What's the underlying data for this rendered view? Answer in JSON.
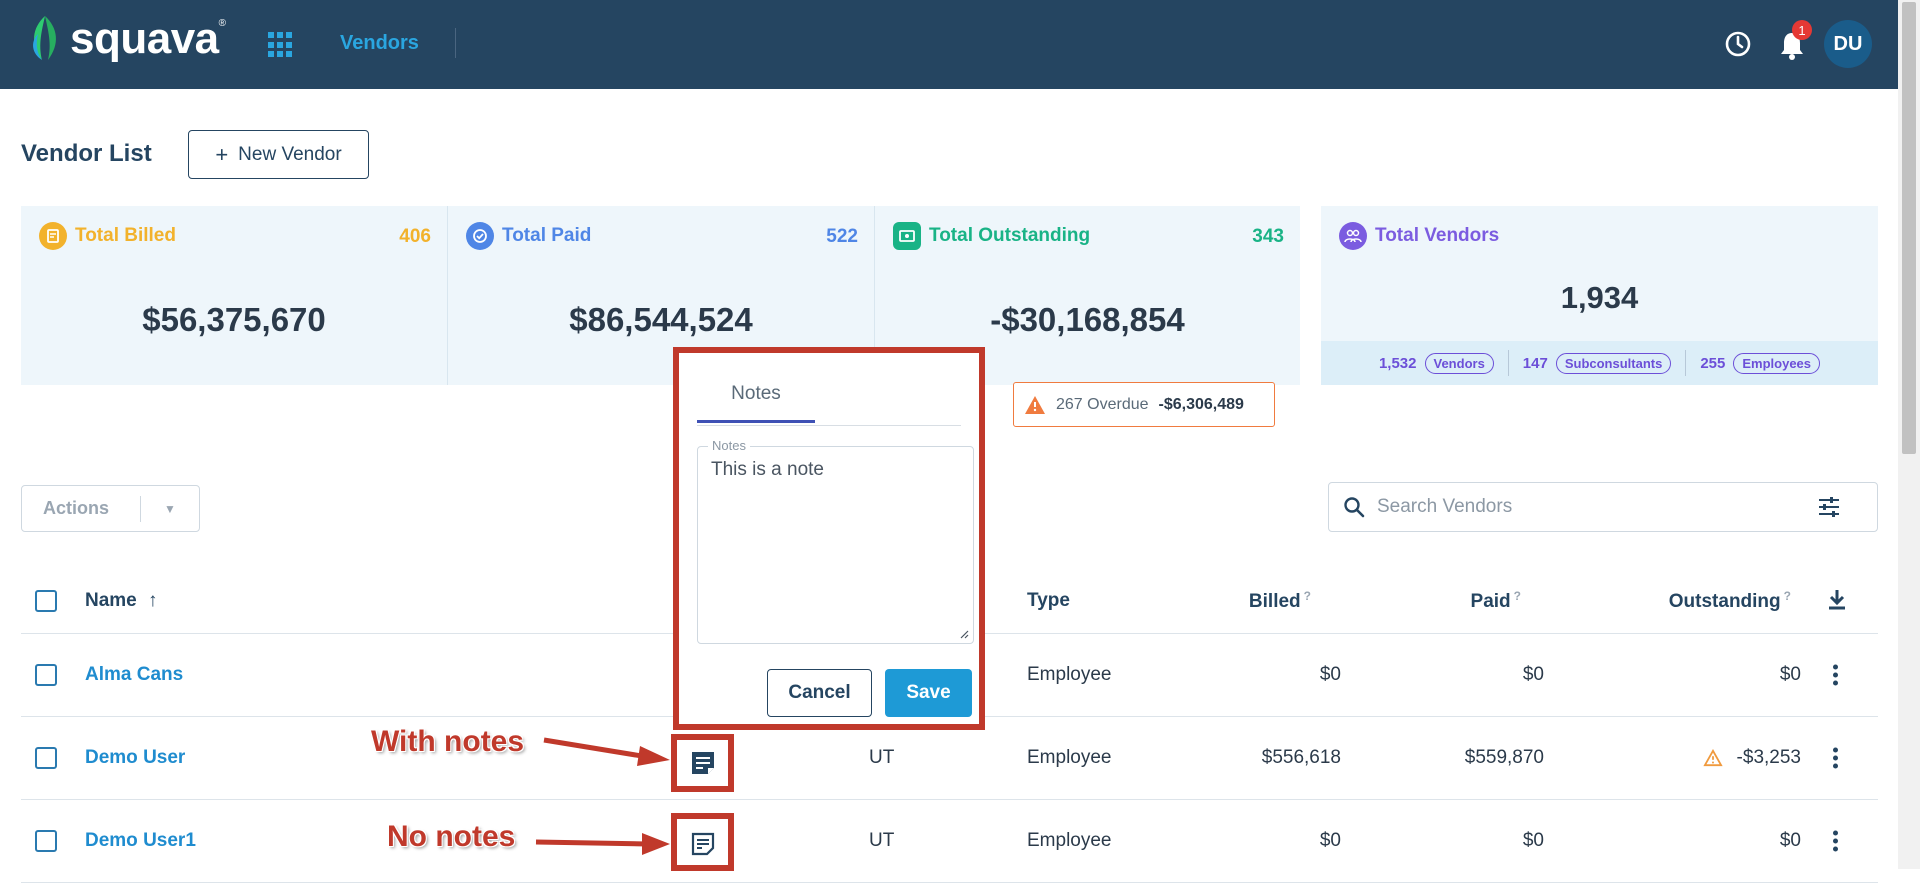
{
  "app": {
    "brand": "squava",
    "brand_mark": "®",
    "nav_link": "Vendors",
    "notification_count": "1",
    "avatar_initials": "DU"
  },
  "page": {
    "title": "Vendor List",
    "new_vendor_label": "New Vendor"
  },
  "stats": {
    "billed": {
      "label": "Total Billed",
      "count": "406",
      "value": "$56,375,670",
      "color": "#f2b22c"
    },
    "paid": {
      "label": "Total Paid",
      "count": "522",
      "value": "$86,544,524",
      "color": "#4f86e6"
    },
    "outstanding": {
      "label": "Total Outstanding",
      "count": "343",
      "value": "-$30,168,854",
      "color": "#19b386"
    },
    "vendors": {
      "label": "Total Vendors",
      "value": "1,934",
      "color": "#7b5ce0",
      "breakdown": [
        {
          "count": "1,532",
          "label": "Vendors"
        },
        {
          "count": "147",
          "label": "Subconsultants"
        },
        {
          "count": "255",
          "label": "Employees"
        }
      ]
    },
    "overdue": {
      "text": "267 Overdue",
      "amount": "-$6,306,489"
    }
  },
  "toolbar": {
    "actions_label": "Actions",
    "search_placeholder": "Search Vendors"
  },
  "table": {
    "headers": {
      "name": "Name",
      "type": "Type",
      "billed": "Billed",
      "paid": "Paid",
      "outstanding": "Outstanding",
      "help_mark": "?"
    },
    "rows": [
      {
        "name": "Alma Cans",
        "state": "",
        "type": "Employee",
        "billed": "$0",
        "paid": "$0",
        "outstanding": "$0"
      },
      {
        "name": "Demo User",
        "state": "UT",
        "type": "Employee",
        "billed": "$556,618",
        "paid": "$559,870",
        "outstanding": "-$3,253"
      },
      {
        "name": "Demo User1",
        "state": "UT",
        "type": "Employee",
        "billed": "$0",
        "paid": "$0",
        "outstanding": "$0"
      }
    ]
  },
  "notes_popup": {
    "tab_label": "Notes",
    "field_label": "Notes",
    "field_value": "This is a note",
    "cancel_label": "Cancel",
    "save_label": "Save"
  },
  "annotations": {
    "with_notes": "With notes",
    "no_notes": "No notes"
  }
}
